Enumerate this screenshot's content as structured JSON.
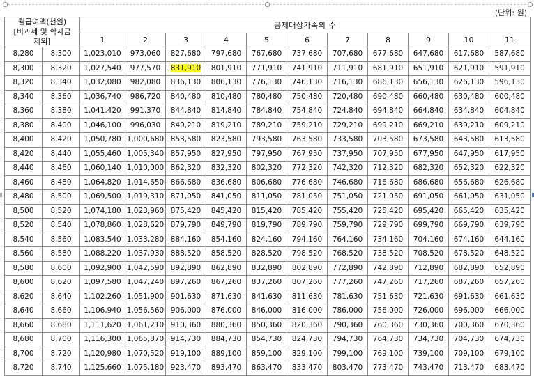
{
  "unit_label": "(단위: 원)",
  "header": {
    "corner_lines": [
      "월급여액(천원)",
      "[비과세 및 학자금",
      "제외]"
    ],
    "group_label": "공제대상가족의 수",
    "family_counts": [
      "1",
      "2",
      "3",
      "4",
      "5",
      "6",
      "7",
      "8",
      "9",
      "10",
      "11"
    ]
  },
  "rows": [
    [
      "8,280",
      "8,300",
      "1,023,010",
      "973,060",
      "827,680",
      "797,680",
      "767,680",
      "737,680",
      "707,680",
      "677,680",
      "647,680",
      "617,680",
      "587,680"
    ],
    [
      "8,300",
      "8,320",
      "1,027,540",
      "977,570",
      "831,910",
      "801,910",
      "771,910",
      "741,910",
      "711,910",
      "681,910",
      "651,910",
      "621,910",
      "591,910"
    ],
    [
      "8,320",
      "8,340",
      "1,032,080",
      "982,080",
      "836,130",
      "806,130",
      "776,130",
      "746,130",
      "716,130",
      "686,130",
      "656,130",
      "626,130",
      "596,130"
    ],
    [
      "8,340",
      "8,360",
      "1,036,740",
      "986,720",
      "840,480",
      "810,480",
      "780,480",
      "750,480",
      "720,480",
      "690,480",
      "660,480",
      "630,480",
      "600,480"
    ],
    [
      "8,360",
      "8,380",
      "1,041,420",
      "991,370",
      "844,840",
      "814,840",
      "784,840",
      "754,840",
      "724,840",
      "694,840",
      "664,840",
      "634,840",
      "604,840"
    ],
    [
      "8,380",
      "8,400",
      "1,046,100",
      "996,030",
      "849,210",
      "819,210",
      "789,210",
      "759,210",
      "729,210",
      "699,210",
      "669,210",
      "639,210",
      "609,210"
    ],
    [
      "8,400",
      "8,420",
      "1,050,780",
      "1,000,680",
      "853,580",
      "823,580",
      "793,580",
      "763,580",
      "733,580",
      "703,580",
      "673,580",
      "643,580",
      "613,580"
    ],
    [
      "8,420",
      "8,440",
      "1,055,460",
      "1,005,340",
      "857,950",
      "827,950",
      "797,950",
      "767,950",
      "737,950",
      "707,950",
      "677,950",
      "647,950",
      "617,950"
    ],
    [
      "8,440",
      "8,460",
      "1,060,140",
      "1,010,000",
      "862,320",
      "832,320",
      "802,320",
      "772,320",
      "742,320",
      "712,320",
      "682,320",
      "652,320",
      "622,320"
    ],
    [
      "8,460",
      "8,480",
      "1,064,820",
      "1,014,650",
      "866,680",
      "836,680",
      "806,680",
      "776,680",
      "746,680",
      "716,680",
      "686,680",
      "656,680",
      "626,680"
    ],
    [
      "8,480",
      "8,500",
      "1,069,500",
      "1,019,310",
      "871,050",
      "841,050",
      "811,050",
      "781,050",
      "751,050",
      "721,050",
      "691,050",
      "661,050",
      "631,050"
    ],
    [
      "8,500",
      "8,520",
      "1,074,180",
      "1,023,960",
      "875,420",
      "845,420",
      "815,420",
      "785,420",
      "755,420",
      "725,420",
      "695,420",
      "665,420",
      "635,420"
    ],
    [
      "8,520",
      "8,540",
      "1,078,860",
      "1,028,620",
      "879,790",
      "849,790",
      "819,790",
      "789,790",
      "759,790",
      "729,790",
      "699,790",
      "669,790",
      "639,790"
    ],
    [
      "8,540",
      "8,560",
      "1,083,540",
      "1,033,280",
      "884,160",
      "854,160",
      "824,160",
      "794,160",
      "764,160",
      "734,160",
      "704,160",
      "674,160",
      "644,160"
    ],
    [
      "8,560",
      "8,580",
      "1,088,220",
      "1,037,930",
      "888,520",
      "858,520",
      "828,520",
      "798,520",
      "768,520",
      "738,520",
      "708,520",
      "678,520",
      "648,520"
    ],
    [
      "8,580",
      "8,600",
      "1,092,900",
      "1,042,590",
      "892,890",
      "862,890",
      "832,890",
      "802,890",
      "772,890",
      "742,890",
      "712,890",
      "682,890",
      "652,890"
    ],
    [
      "8,600",
      "8,620",
      "1,097,580",
      "1,047,240",
      "897,260",
      "867,260",
      "837,260",
      "807,260",
      "777,260",
      "747,260",
      "717,260",
      "687,260",
      "657,260"
    ],
    [
      "8,620",
      "8,640",
      "1,102,260",
      "1,051,900",
      "901,630",
      "871,630",
      "841,630",
      "811,630",
      "781,630",
      "751,630",
      "721,630",
      "691,630",
      "661,630"
    ],
    [
      "8,640",
      "8,660",
      "1,106,940",
      "1,056,560",
      "906,000",
      "876,000",
      "846,000",
      "816,000",
      "786,000",
      "756,000",
      "726,000",
      "696,000",
      "666,000"
    ],
    [
      "8,660",
      "8,680",
      "1,111,620",
      "1,061,210",
      "910,360",
      "880,360",
      "850,360",
      "820,360",
      "790,360",
      "760,360",
      "730,360",
      "700,360",
      "670,360"
    ],
    [
      "8,680",
      "8,700",
      "1,116,300",
      "1,065,870",
      "914,730",
      "884,730",
      "854,730",
      "824,730",
      "794,730",
      "764,730",
      "734,730",
      "704,730",
      "674,730"
    ],
    [
      "8,700",
      "8,720",
      "1,120,980",
      "1,070,520",
      "919,100",
      "889,100",
      "859,100",
      "829,100",
      "799,100",
      "769,100",
      "739,100",
      "709,100",
      "679,100"
    ],
    [
      "8,720",
      "8,740",
      "1,125,660",
      "1,075,180",
      "923,470",
      "893,470",
      "863,470",
      "833,470",
      "803,470",
      "773,470",
      "743,470",
      "713,470",
      "683,470"
    ]
  ],
  "highlight": {
    "row": 1,
    "col": 4,
    "color": "#ffff00"
  }
}
